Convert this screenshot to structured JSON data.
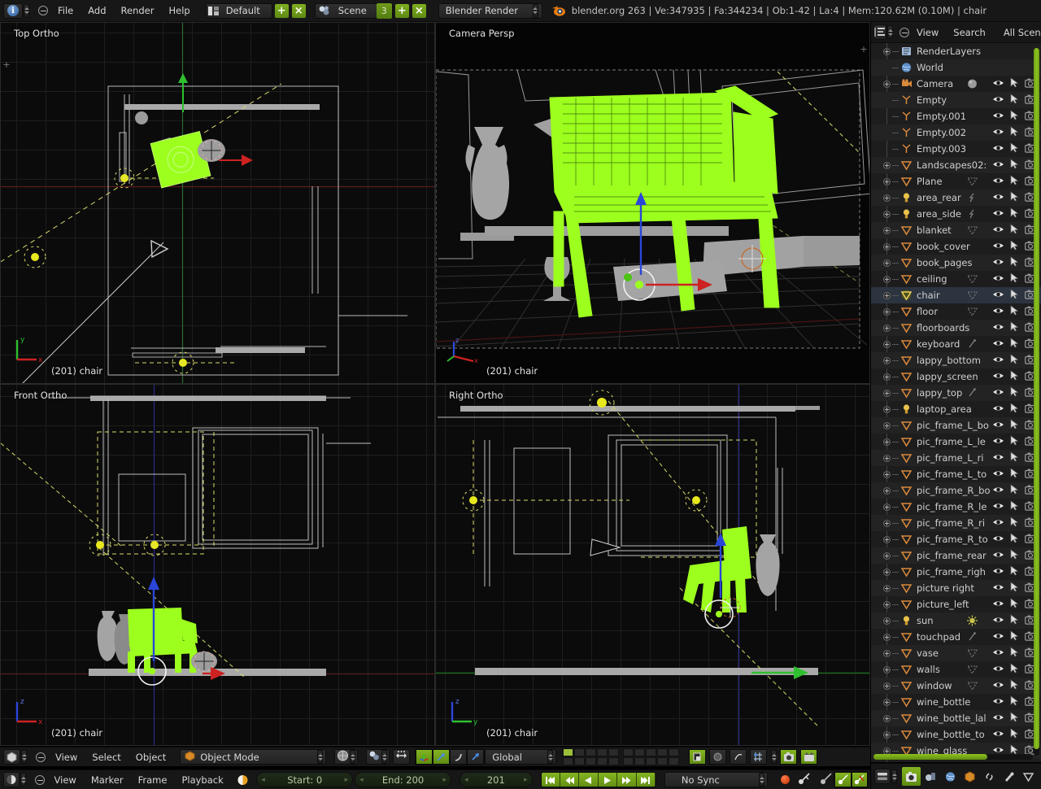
{
  "topbar": {
    "menus": [
      "File",
      "Add",
      "Render",
      "Help"
    ],
    "screen_layout": "Default",
    "scene_name": "Scene",
    "scene_users": "3",
    "render_engine": "Blender Render",
    "add_label": "+",
    "remove_label": "×",
    "stats": "blender.org 263 | Ve:347935 | Fa:344234 | Ob:1-42 | La:4 | Mem:120.62M (0.10M) | chair"
  },
  "viewports": [
    {
      "id": "top",
      "view_name": "Top Ortho",
      "object_label": "(201) chair",
      "axis": [
        "y",
        "x"
      ]
    },
    {
      "id": "camera",
      "view_name": "Camera Persp",
      "object_label": "(201) chair",
      "axis": [
        "z",
        "x"
      ]
    },
    {
      "id": "front",
      "view_name": "Front Ortho",
      "object_label": "(201) chair",
      "axis": [
        "z",
        "x"
      ]
    },
    {
      "id": "right",
      "view_name": "Right Ortho",
      "object_label": "(201) chair",
      "axis": [
        "z",
        "y"
      ]
    }
  ],
  "outliner": {
    "header": {
      "view": "View",
      "search": "Search",
      "display_mode": "All Scenes"
    },
    "items": [
      {
        "name": "RenderLayers",
        "icon": "renderlayers",
        "expand": true,
        "indent": 1,
        "data_icon": "",
        "eye": false,
        "cursor": false,
        "cam": false,
        "selected": false
      },
      {
        "name": "World",
        "icon": "world",
        "expand": false,
        "indent": 1,
        "data_icon": "",
        "eye": false,
        "cursor": false,
        "cam": false,
        "selected": false
      },
      {
        "name": "Camera",
        "icon": "camera",
        "expand": true,
        "indent": 0,
        "data_icon": "sphere",
        "eye": true,
        "cursor": true,
        "cam": true,
        "selected": false
      },
      {
        "name": "Empty",
        "icon": "empty",
        "expand": false,
        "indent": 0,
        "data_icon": "",
        "eye": true,
        "cursor": true,
        "cam": true,
        "selected": false
      },
      {
        "name": "Empty.001",
        "icon": "empty",
        "expand": false,
        "indent": 0,
        "data_icon": "",
        "eye": true,
        "cursor": true,
        "cam": true,
        "selected": false
      },
      {
        "name": "Empty.002",
        "icon": "empty",
        "expand": false,
        "indent": 0,
        "data_icon": "",
        "eye": true,
        "cursor": true,
        "cam": true,
        "selected": false
      },
      {
        "name": "Empty.003",
        "icon": "empty",
        "expand": false,
        "indent": 0,
        "data_icon": "",
        "eye": true,
        "cursor": true,
        "cam": true,
        "selected": false
      },
      {
        "name": "Landscapes02:",
        "icon": "mesh",
        "expand": true,
        "indent": 0,
        "data_icon": "",
        "eye": true,
        "cursor": true,
        "cam": true,
        "selected": false
      },
      {
        "name": "Plane",
        "icon": "mesh",
        "expand": true,
        "indent": 0,
        "data_icon": "mesh",
        "eye": true,
        "cursor": true,
        "cam": true,
        "selected": false
      },
      {
        "name": "area_rear",
        "icon": "lamp",
        "expand": true,
        "indent": 0,
        "data_icon": "lamp",
        "eye": true,
        "cursor": true,
        "cam": true,
        "selected": false
      },
      {
        "name": "area_side",
        "icon": "lamp",
        "expand": true,
        "indent": 0,
        "data_icon": "lamp",
        "eye": true,
        "cursor": true,
        "cam": true,
        "selected": false
      },
      {
        "name": "blanket",
        "icon": "mesh",
        "expand": true,
        "indent": 0,
        "data_icon": "mesh",
        "eye": true,
        "cursor": true,
        "cam": true,
        "selected": false
      },
      {
        "name": "book_cover",
        "icon": "mesh",
        "expand": true,
        "indent": 0,
        "data_icon": "",
        "eye": true,
        "cursor": true,
        "cam": true,
        "selected": false
      },
      {
        "name": "book_pages",
        "icon": "mesh",
        "expand": true,
        "indent": 0,
        "data_icon": "",
        "eye": true,
        "cursor": true,
        "cam": true,
        "selected": false
      },
      {
        "name": "ceiling",
        "icon": "mesh",
        "expand": true,
        "indent": 0,
        "data_icon": "mesh",
        "eye": true,
        "cursor": true,
        "cam": true,
        "selected": false
      },
      {
        "name": "chair",
        "icon": "mesh-active",
        "expand": true,
        "indent": 0,
        "data_icon": "mesh",
        "eye": true,
        "cursor": true,
        "cam": true,
        "selected": true
      },
      {
        "name": "floor",
        "icon": "mesh",
        "expand": true,
        "indent": 0,
        "data_icon": "mesh",
        "eye": true,
        "cursor": true,
        "cam": true,
        "selected": false
      },
      {
        "name": "floorboards",
        "icon": "mesh",
        "expand": true,
        "indent": 0,
        "data_icon": "",
        "eye": true,
        "cursor": true,
        "cam": true,
        "selected": false
      },
      {
        "name": "keyboard",
        "icon": "mesh",
        "expand": true,
        "indent": 0,
        "data_icon": "mod",
        "eye": true,
        "cursor": true,
        "cam": true,
        "selected": false
      },
      {
        "name": "lappy_bottom",
        "icon": "mesh",
        "expand": true,
        "indent": 0,
        "data_icon": "",
        "eye": true,
        "cursor": true,
        "cam": true,
        "selected": false
      },
      {
        "name": "lappy_screen",
        "icon": "mesh",
        "expand": true,
        "indent": 0,
        "data_icon": "",
        "eye": true,
        "cursor": true,
        "cam": true,
        "selected": false
      },
      {
        "name": "lappy_top",
        "icon": "mesh",
        "expand": true,
        "indent": 0,
        "data_icon": "mod",
        "eye": true,
        "cursor": true,
        "cam": true,
        "selected": false
      },
      {
        "name": "laptop_area",
        "icon": "lamp",
        "expand": true,
        "indent": 0,
        "data_icon": "",
        "eye": true,
        "cursor": true,
        "cam": true,
        "selected": false
      },
      {
        "name": "pic_frame_L_bo",
        "icon": "mesh",
        "expand": true,
        "indent": 0,
        "data_icon": "",
        "eye": true,
        "cursor": true,
        "cam": true,
        "selected": false
      },
      {
        "name": "pic_frame_L_le",
        "icon": "mesh",
        "expand": true,
        "indent": 0,
        "data_icon": "",
        "eye": true,
        "cursor": true,
        "cam": true,
        "selected": false
      },
      {
        "name": "pic_frame_L_ri",
        "icon": "mesh",
        "expand": true,
        "indent": 0,
        "data_icon": "",
        "eye": true,
        "cursor": true,
        "cam": true,
        "selected": false
      },
      {
        "name": "pic_frame_L_to",
        "icon": "mesh",
        "expand": true,
        "indent": 0,
        "data_icon": "",
        "eye": true,
        "cursor": true,
        "cam": true,
        "selected": false
      },
      {
        "name": "pic_frame_R_bo",
        "icon": "mesh",
        "expand": true,
        "indent": 0,
        "data_icon": "",
        "eye": true,
        "cursor": true,
        "cam": true,
        "selected": false
      },
      {
        "name": "pic_frame_R_le",
        "icon": "mesh",
        "expand": true,
        "indent": 0,
        "data_icon": "",
        "eye": true,
        "cursor": true,
        "cam": true,
        "selected": false
      },
      {
        "name": "pic_frame_R_ri",
        "icon": "mesh",
        "expand": true,
        "indent": 0,
        "data_icon": "",
        "eye": true,
        "cursor": true,
        "cam": true,
        "selected": false
      },
      {
        "name": "pic_frame_R_to",
        "icon": "mesh",
        "expand": true,
        "indent": 0,
        "data_icon": "",
        "eye": true,
        "cursor": true,
        "cam": true,
        "selected": false
      },
      {
        "name": "pic_frame_rear",
        "icon": "mesh",
        "expand": true,
        "indent": 0,
        "data_icon": "",
        "eye": true,
        "cursor": true,
        "cam": true,
        "selected": false
      },
      {
        "name": "pic_frame_righ",
        "icon": "mesh",
        "expand": true,
        "indent": 0,
        "data_icon": "",
        "eye": true,
        "cursor": true,
        "cam": true,
        "selected": false
      },
      {
        "name": "picture right",
        "icon": "mesh",
        "expand": true,
        "indent": 0,
        "data_icon": "",
        "eye": true,
        "cursor": true,
        "cam": true,
        "selected": false
      },
      {
        "name": "picture_left",
        "icon": "mesh",
        "expand": true,
        "indent": 0,
        "data_icon": "",
        "eye": true,
        "cursor": true,
        "cam": true,
        "selected": false
      },
      {
        "name": "sun",
        "icon": "lamp",
        "expand": true,
        "indent": 0,
        "data_icon": "sun",
        "eye": true,
        "cursor": true,
        "cam": true,
        "selected": false
      },
      {
        "name": "touchpad",
        "icon": "mesh",
        "expand": true,
        "indent": 0,
        "data_icon": "mod",
        "eye": true,
        "cursor": true,
        "cam": true,
        "selected": false
      },
      {
        "name": "vase",
        "icon": "mesh",
        "expand": true,
        "indent": 0,
        "data_icon": "mesh",
        "eye": true,
        "cursor": true,
        "cam": true,
        "selected": false
      },
      {
        "name": "walls",
        "icon": "mesh",
        "expand": true,
        "indent": 0,
        "data_icon": "mesh",
        "eye": true,
        "cursor": true,
        "cam": true,
        "selected": false
      },
      {
        "name": "window",
        "icon": "mesh",
        "expand": true,
        "indent": 0,
        "data_icon": "mesh",
        "eye": true,
        "cursor": true,
        "cam": true,
        "selected": false
      },
      {
        "name": "wine_bottle",
        "icon": "mesh",
        "expand": true,
        "indent": 0,
        "data_icon": "",
        "eye": true,
        "cursor": true,
        "cam": true,
        "selected": false
      },
      {
        "name": "wine_bottle_lal",
        "icon": "mesh",
        "expand": true,
        "indent": 0,
        "data_icon": "",
        "eye": true,
        "cursor": true,
        "cam": true,
        "selected": false
      },
      {
        "name": "wine_bottle_to",
        "icon": "mesh",
        "expand": true,
        "indent": 0,
        "data_icon": "",
        "eye": true,
        "cursor": true,
        "cam": true,
        "selected": false
      },
      {
        "name": "wine_glass",
        "icon": "mesh",
        "expand": true,
        "indent": 0,
        "data_icon": "",
        "eye": true,
        "cursor": true,
        "cam": true,
        "selected": false
      }
    ]
  },
  "view_footer": {
    "menus": [
      "View",
      "Select",
      "Object"
    ],
    "mode": "Object Mode",
    "transform_orientation": "Global"
  },
  "timeline": {
    "menus": [
      "View",
      "Marker",
      "Frame",
      "Playback"
    ],
    "start": "Start: 0",
    "end": "End: 200",
    "current_frame": "201",
    "sync_mode": "No Sync"
  },
  "colors": {
    "accent_green": "#84b521",
    "selected_object": "#9cff1e",
    "panel_bg": "#1d1d1d",
    "header_bg": "#171717",
    "viewport_bg": "#0b0b0b",
    "text": "#d4d4d4",
    "axis_x": "#cc2222",
    "axis_y": "#33bb33",
    "axis_z": "#2244dd",
    "lamp_yellow": "#e8e81f",
    "wire_gray": "#bdbdbd"
  }
}
